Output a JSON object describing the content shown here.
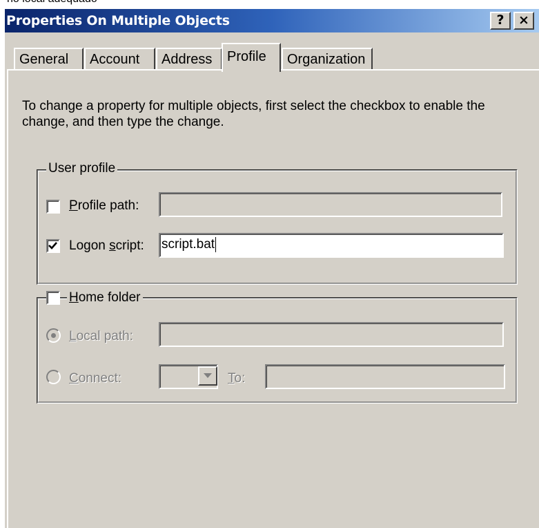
{
  "background_text": "no local adequado",
  "window": {
    "title": "Properties On Multiple Objects",
    "help_button": "?",
    "close_button": "×"
  },
  "tabs": [
    {
      "label": "General",
      "active": false
    },
    {
      "label": "Account",
      "active": false
    },
    {
      "label": "Address",
      "active": false
    },
    {
      "label": "Profile",
      "active": true
    },
    {
      "label": "Organization",
      "active": false
    }
  ],
  "description": "To change a property for multiple objects, first select the checkbox to enable the change, and then type the change.",
  "user_profile": {
    "group_title": "User profile",
    "profile_path": {
      "label": "Profile path:",
      "checked": false,
      "value": ""
    },
    "logon_script": {
      "label": "Logon script:",
      "checked": true,
      "value": "script.bat"
    }
  },
  "home_folder": {
    "group_title": "Home folder",
    "checked": false,
    "local_path": {
      "label": "Local path:",
      "selected": true,
      "value": ""
    },
    "connect": {
      "label": "Connect:",
      "selected": false,
      "drive": "",
      "to_label": "To:",
      "to_value": ""
    }
  },
  "colors": {
    "title_gradient_start": "#0a246a",
    "title_gradient_end": "#a6caf0",
    "dialog_face": "#d4d0c8",
    "disabled_text": "#808080"
  }
}
